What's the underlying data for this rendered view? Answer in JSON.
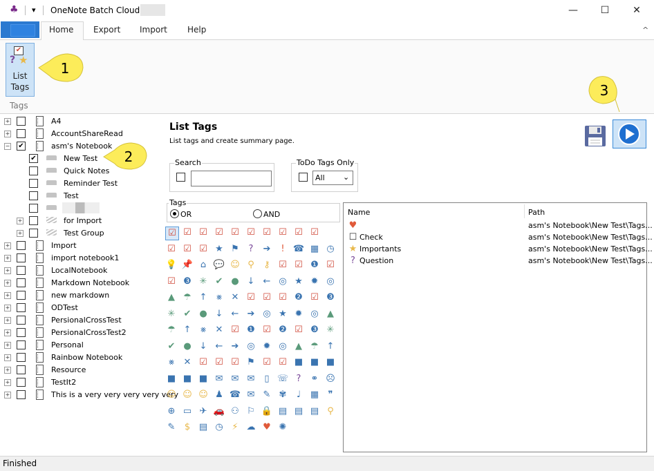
{
  "window": {
    "title": "OneNote Batch Cloud",
    "minimize": "—",
    "maximize": "☐",
    "close": "✕"
  },
  "ribbon": {
    "tabs": [
      "Home",
      "Export",
      "Import",
      "Help"
    ],
    "list_tags_label1": "List",
    "list_tags_label2": "Tags",
    "group_label": "Tags",
    "collapse": "^"
  },
  "callouts": [
    "1",
    "2",
    "3"
  ],
  "tree": [
    {
      "label": "A4",
      "level": 0,
      "expander": true,
      "checked": false,
      "icon": "notebook"
    },
    {
      "label": "AccountShareRead",
      "level": 0,
      "expander": true,
      "checked": false,
      "icon": "notebook"
    },
    {
      "label": "asm's Notebook",
      "level": 0,
      "expander": true,
      "expanded": true,
      "checked": true,
      "icon": "notebook"
    },
    {
      "label": "New Test",
      "level": 1,
      "expander": false,
      "checked": true,
      "icon": "section",
      "selected": true
    },
    {
      "label": "Quick Notes",
      "level": 1,
      "expander": false,
      "checked": false,
      "icon": "section"
    },
    {
      "label": "Reminder Test",
      "level": 1,
      "expander": false,
      "checked": false,
      "icon": "section"
    },
    {
      "label": "Test",
      "level": 1,
      "expander": false,
      "checked": false,
      "icon": "section"
    },
    {
      "label": "",
      "level": 1,
      "expander": false,
      "checked": false,
      "icon": "section",
      "redacted": true
    },
    {
      "label": "for Import",
      "level": 1,
      "expander": true,
      "checked": false,
      "icon": "group"
    },
    {
      "label": "Test Group",
      "level": 1,
      "expander": true,
      "checked": false,
      "icon": "group"
    },
    {
      "label": "Import",
      "level": 0,
      "expander": true,
      "checked": false,
      "icon": "notebook"
    },
    {
      "label": "import notebook1",
      "level": 0,
      "expander": true,
      "checked": false,
      "icon": "notebook"
    },
    {
      "label": "LocalNotebook",
      "level": 0,
      "expander": true,
      "checked": false,
      "icon": "notebook"
    },
    {
      "label": "Markdown Notebook",
      "level": 0,
      "expander": true,
      "checked": false,
      "icon": "notebook"
    },
    {
      "label": "new markdown",
      "level": 0,
      "expander": true,
      "checked": false,
      "icon": "notebook"
    },
    {
      "label": "ODTest",
      "level": 0,
      "expander": true,
      "checked": false,
      "icon": "notebook"
    },
    {
      "label": "PersionalCrossTest",
      "level": 0,
      "expander": true,
      "checked": false,
      "icon": "notebook"
    },
    {
      "label": "PersionalCrossTest2",
      "level": 0,
      "expander": true,
      "checked": false,
      "icon": "notebook"
    },
    {
      "label": "Personal",
      "level": 0,
      "expander": true,
      "checked": false,
      "icon": "notebook"
    },
    {
      "label": "Rainbow Notebook",
      "level": 0,
      "expander": true,
      "checked": false,
      "icon": "notebook"
    },
    {
      "label": "Resource",
      "level": 0,
      "expander": true,
      "checked": false,
      "icon": "notebook"
    },
    {
      "label": "TestIt2",
      "level": 0,
      "expander": true,
      "checked": false,
      "icon": "notebook"
    },
    {
      "label": "This is a very very very very very",
      "level": 0,
      "expander": true,
      "checked": false,
      "icon": "notebook"
    }
  ],
  "panel": {
    "title": "List Tags",
    "description": "List tags and create summary page.",
    "search_label": "Search",
    "search_value": "",
    "todo_label": "ToDo Tags Only",
    "todo_value": "All",
    "tags_label": "Tags",
    "or_label": "OR",
    "and_label": "AND",
    "or_selected": true
  },
  "tag_icons": [
    [
      "☑",
      "☑",
      "☑",
      "☑",
      "☑",
      "☑",
      "☑",
      "☑",
      "☑",
      "☑",
      "",
      ""
    ],
    [
      "☑",
      "☑",
      "☑",
      "★",
      "⚑",
      "?",
      "➔",
      "!",
      "☎",
      "▦",
      "◷",
      ""
    ],
    [
      "💡",
      "📌",
      "⌂",
      "💬",
      "☺",
      "⚲",
      "⚷",
      "☑",
      "☑",
      "❶",
      "☑",
      "❷"
    ],
    [
      "☑",
      "❸",
      "✳",
      "✔",
      "●",
      "↓",
      "←",
      "◎",
      "★",
      "✹",
      "◎",
      ""
    ],
    [
      "▲",
      "☂",
      "↑",
      "⨳",
      "✕",
      "☑",
      "☑",
      "☑",
      "❷",
      "☑",
      "❸",
      ""
    ],
    [
      "✳",
      "✔",
      "●",
      "↓",
      "←",
      "➔",
      "◎",
      "★",
      "✹",
      "◎",
      "▲",
      ""
    ],
    [
      "☂",
      "↑",
      "⨳",
      "✕",
      "☑",
      "❶",
      "☑",
      "❷",
      "☑",
      "❸",
      "✳",
      ""
    ],
    [
      "✔",
      "●",
      "↓",
      "←",
      "➔",
      "◎",
      "✹",
      "◎",
      "▲",
      "☂",
      "↑",
      ""
    ],
    [
      "⨳",
      "✕",
      "☑",
      "☑",
      "☑",
      "⚑",
      "☑",
      "☑",
      "■",
      "■",
      "■",
      ""
    ],
    [
      "■",
      "■",
      "■",
      "✉",
      "✉",
      "✉",
      "▯",
      "☏",
      "?",
      "⚭",
      "☹",
      ""
    ],
    [
      "☺",
      "☺",
      "☺",
      "♟",
      "☎",
      "✉",
      "✎",
      "✾",
      "♩",
      "▦",
      "❞",
      "⊕"
    ],
    [
      "⊕",
      "▭",
      "✈",
      "🚗",
      "⚇",
      "⚐",
      "🔒",
      "▤",
      "▤",
      "▤",
      "⚲",
      ""
    ],
    [
      "✎",
      "$",
      "▤",
      "◷",
      "⚡",
      "☁",
      "♥",
      "✺",
      "",
      "",
      "",
      ""
    ]
  ],
  "results": {
    "col_name": "Name",
    "col_path": "Path",
    "rows": [
      {
        "icon": "♥",
        "name": "",
        "path": "asm's Notebook\\New Test\\Tags..."
      },
      {
        "icon": "☐",
        "name": "Check",
        "path": "asm's Notebook\\New Test\\Tags..."
      },
      {
        "icon": "★",
        "name": "Importants",
        "path": "asm's Notebook\\New Test\\Tags..."
      },
      {
        "icon": "?",
        "name": "Question",
        "path": "asm's Notebook\\New Test\\Tags..."
      }
    ]
  },
  "status": "Finished",
  "colors": {
    "accent": "#2b79d0",
    "callout": "#fcec5a",
    "check_red": "#d04a3a",
    "star_gold": "#e8b84a",
    "question_purple": "#7a4a9a",
    "heart_red": "#e05a3a",
    "icon_blue": "#3a74b0",
    "icon_green": "#5a9a7a"
  }
}
